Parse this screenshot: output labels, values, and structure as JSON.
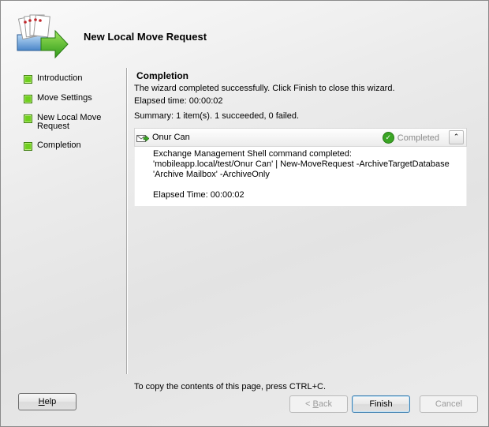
{
  "header": {
    "title": "New Local Move Request",
    "icon": "mailbox-move-icon"
  },
  "nav": {
    "items": [
      {
        "label": "Introduction"
      },
      {
        "label": "Move Settings"
      },
      {
        "label": "New Local Move Request"
      },
      {
        "label": "Completion"
      }
    ]
  },
  "content": {
    "section_title": "Completion",
    "success_message": "The wizard completed successfully. Click Finish to close this wizard.",
    "elapsed": "Elapsed time: 00:00:02",
    "summary": "Summary: 1 item(s). 1 succeeded, 0 failed.",
    "result": {
      "user": "Onur Can",
      "status": "Completed",
      "command_line1": "Exchange Management Shell command completed:",
      "command_line2": "'mobileapp.local/test/Onur Can' | New-MoveRequest -ArchiveTargetDatabase",
      "command_line3": "'Archive Mailbox' -ArchiveOnly",
      "elapsed": "Elapsed Time: 00:00:02"
    },
    "copy_note": "To copy the contents of this page, press CTRL+C."
  },
  "buttons": {
    "help_first": "H",
    "help_rest": "elp",
    "back_prefix": "< ",
    "back_first": "B",
    "back_rest": "ack",
    "finish": "Finish",
    "cancel": "Cancel"
  },
  "colors": {
    "nav_bullet": "#6fcf1f",
    "completed_check": "#3aa524",
    "finish_focus": "#3c7fb1"
  }
}
